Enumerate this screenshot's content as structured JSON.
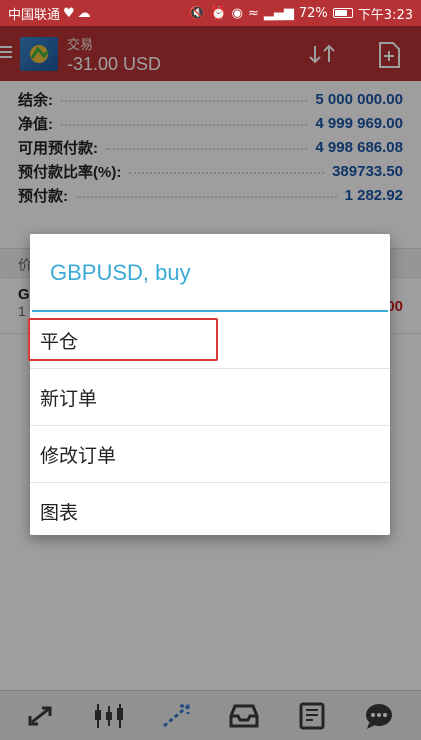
{
  "status_bar": {
    "carrier": "中国联通",
    "battery": "72%",
    "battery_level": 0.72,
    "time": "下午3:23"
  },
  "header": {
    "title": "交易",
    "balance": "-31.00 USD"
  },
  "account": [
    {
      "label": "结余:",
      "value": "5 000 000.00"
    },
    {
      "label": "净值:",
      "value": "4 999 969.00"
    },
    {
      "label": "可用预付款:",
      "value": "4 998 686.08"
    },
    {
      "label": "预付款比率(%):",
      "value": "389733.50"
    },
    {
      "label": "预付款:",
      "value": "1 282.92"
    }
  ],
  "background": {
    "section_prefix": "价",
    "position_symbol": "GI",
    "position_sub": "1",
    "position_profit": "00"
  },
  "dialog": {
    "title": "GBPUSD, buy",
    "items": [
      "平仓",
      "新订单",
      "修改订单",
      "图表"
    ],
    "highlight_color": "#d93636"
  },
  "colors": {
    "brand_red": "#b73235",
    "value_blue": "#1a56a6",
    "dialog_accent": "#3aa9d5"
  },
  "bottom_nav": {
    "icons": [
      "quotes-icon",
      "chart-candles-icon",
      "trade-icon",
      "history-inbox-icon",
      "news-icon",
      "chat-icon"
    ]
  }
}
